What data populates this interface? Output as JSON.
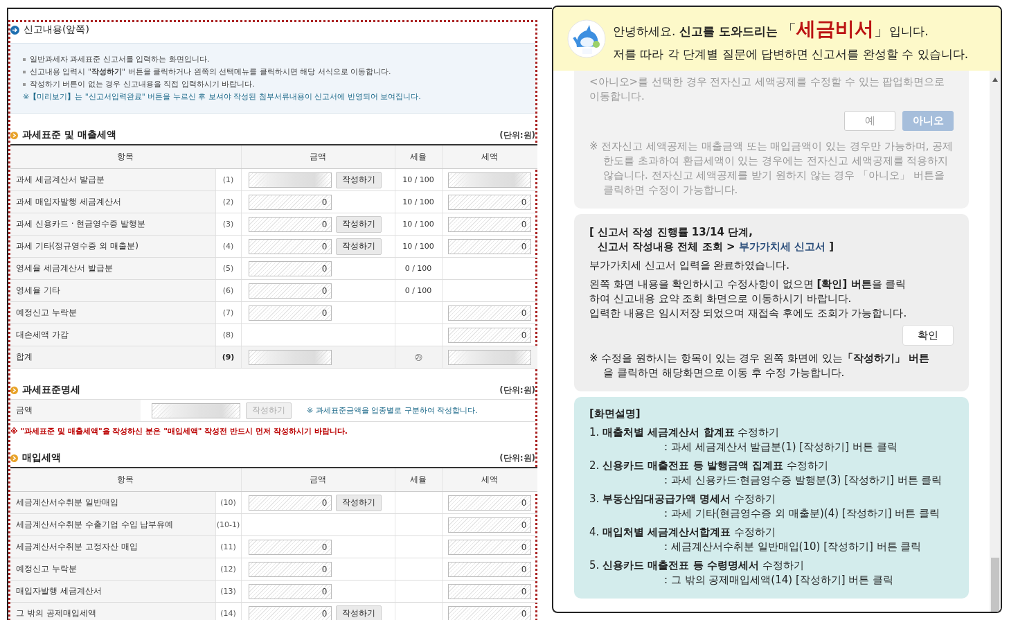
{
  "form": {
    "title": "신고내용(앞쪽)",
    "info": {
      "bullets": [
        "일반과세자 과세표준 신고서를 입력하는 화면입니다.",
        "신고내용 입력시 \"**작성하기**\" 버튼을 클릭하거나 왼쪽의 선택메뉴를 클릭하시면 해당 서식으로 이동합니다.",
        "작성하기 버튼이 없는 경우 신고내용을 직접 입력하시기 바랍니다."
      ],
      "note": "※**【**미리보기**】**는 \"신고서입력완료\" 버튼을 누르신 후 보셔야 작성된 첨부서류내용이 신고서에 반영되어 보여집니다."
    },
    "sales": {
      "title": "과세표준 및 매출세액",
      "unit": "(단위:원)",
      "columns": [
        "항목",
        "금액",
        "세율",
        "세액"
      ],
      "rows": [
        {
          "label": "과세 세금계산서 발급분",
          "no": "(1)",
          "amount": {
            "masked": true
          },
          "button": "작성하기",
          "rate": "10 / 100",
          "tax": {
            "masked": true
          },
          "total": false
        },
        {
          "label": "과세 매입자발행 세금계산서",
          "no": "(2)",
          "amount": {
            "value": "0"
          },
          "rate": "10 / 100",
          "tax": {
            "value": "0"
          },
          "total": false
        },
        {
          "label": "과세 신용카드 · 현금영수증 발행분",
          "no": "(3)",
          "amount": {
            "value": "0"
          },
          "button": "작성하기",
          "rate": "10 / 100",
          "tax": {
            "value": "0"
          },
          "total": false
        },
        {
          "label": "과세 기타(정규영수증 외 매출분)",
          "no": "(4)",
          "amount": {
            "value": "0"
          },
          "button": "작성하기",
          "rate": "10 / 100",
          "tax": {
            "value": "0"
          },
          "total": false
        },
        {
          "label": "영세율 세금계산서 발급분",
          "no": "(5)",
          "amount": {
            "value": "0"
          },
          "rate": "0 / 100",
          "total": false
        },
        {
          "label": "영세율 기타",
          "no": "(6)",
          "amount": {
            "value": "0"
          },
          "rate": "0 / 100",
          "total": false
        },
        {
          "label": "예정신고 누락분",
          "no": "(7)",
          "amount": {
            "value": "0"
          },
          "tax": {
            "value": "0"
          },
          "total": false
        },
        {
          "label": "대손세액 가감",
          "no": "(8)",
          "tax": {
            "value": "0"
          },
          "total": false
        },
        {
          "label": "합계",
          "no": "(9)",
          "amount": {
            "masked": true
          },
          "rate": "㉮",
          "tax": {
            "masked": true
          },
          "total": true
        }
      ]
    },
    "standard": {
      "title": "과세표준명세",
      "unit": "(단위:원)",
      "label": "금액",
      "amount": {
        "masked": true
      },
      "button": {
        "label": "작성하기",
        "disabled": true
      },
      "note": "※ 과세표준금액을 업종별로 구분하여 작성합니다."
    },
    "warning": "※ \"과세표준 및 매출세액\"을 작성하신 분은 \"매입세액\" 작성전 반드시 먼저 작성하시기 바랍니다.",
    "purchases": {
      "title": "매입세액",
      "unit": "(단위:원)",
      "columns": [
        "항목",
        "금액",
        "세율",
        "세액"
      ],
      "rows": [
        {
          "label": "세금계산서수취분 일반매입",
          "no": "(10)",
          "amount": {
            "value": "0"
          },
          "button": "작성하기",
          "tax": {
            "value": "0"
          },
          "total": false
        },
        {
          "label": "세금계산서수취분 수출기업 수입 납부유예",
          "no": "(10-1)",
          "tax": {
            "value": "0"
          },
          "total": false
        },
        {
          "label": "세금계산서수취분 고정자산 매입",
          "no": "(11)",
          "amount": {
            "value": "0"
          },
          "tax": {
            "value": "0"
          },
          "total": false
        },
        {
          "label": "예정신고 누락분",
          "no": "(12)",
          "amount": {
            "value": "0"
          },
          "tax": {
            "value": "0"
          },
          "total": false
        },
        {
          "label": "매입자발행 세금계산서",
          "no": "(13)",
          "amount": {
            "value": "0"
          },
          "tax": {
            "value": "0"
          },
          "total": false
        },
        {
          "label": "그 밖의 공제매입세액",
          "no": "(14)",
          "amount": {
            "value": "0"
          },
          "button": "작성하기",
          "tax": {
            "value": "0"
          },
          "total": false
        }
      ]
    }
  },
  "assistant": {
    "intro": {
      "before": "안녕하세요. ",
      "bold": "신고를 도와드리는",
      "open": "「",
      "name": "세금비서",
      "close": "」입니다."
    },
    "subtitle": "저를 따라 각 단계별 질문에 답변하면 신고서를 완성할 수 있습니다.",
    "cards": [
      {
        "kind": "question",
        "disabled": true,
        "text": "<아니오>를 선택한 경우 전자신고 세액공제를 수정할 수 있는 팝업화면으로 이동합니다.",
        "buttons": [
          {
            "label": "예",
            "selected": false
          },
          {
            "label": "아니오",
            "selected": true
          }
        ],
        "note": "※ 전자신고 세액공제는 매출금액 또는 매입금액이 있는 경우만 가능하며, 공제한도를 초과하여 환급세액이 있는 경우에는 전자신고 세액공제를 적용하지 않습니다. 전자신고 세액공제를 받기 원하지 않는 경우 「아니오」 버튼을 클릭하면 수정이 가능합니다."
      },
      {
        "kind": "progress",
        "title": {
          "line1": "[ 신고서 작성 진행률 13/14 단계,",
          "line2": "신고서 작성내용 전체 조회 > ",
          "link": "부가가치세 신고서",
          "close": " ]"
        },
        "paragraphs": [
          "부가가치세 신고서 입력을 완료하였습니다.",
          "왼쪽 화면 내용을 확인하시고 수정사항이 없으면 **[확인] 버튼**을 클릭\n하여 신고내용 요약 조회 화면으로 이동하시기 바랍니다.\n입력한 내용은 임시저장 되었으며 재접속 후에도 조회가 가능합니다."
        ],
        "button": "확인",
        "note": "※ 수정을 원하시는 항목이 있는 경우 왼쪽 화면에 있는**「작성하기」 버튼**\n을 클릭하면 해당화면으로 이동 후 수정 가능합니다."
      },
      {
        "kind": "help",
        "heading": "[화면설명]",
        "items": [
          {
            "title": "1. **매출처별 세금계산서 합계표** 수정하기",
            "detail": ": 과세 세금계산서 발급분(1) [작성하기] 버튼 클릭"
          },
          {
            "title": "2. **신용카드 매출전표 등 발행금액 집계표** 수정하기",
            "detail": ": 과세 신용카드·현금영수증 발행분(3) [작성하기] 버튼 클릭"
          },
          {
            "title": "3. **부동산임대공급가액 명세서** 수정하기",
            "detail": ": 과세 기타(현금영수증 외 매출분)(4) [작성하기] 버튼 클릭"
          },
          {
            "title": "4. **매입처별 세금계산서합계표** 수정하기",
            "detail": ": 세금계산서수취분 일반매입(10) [작성하기] 버튼 클릭"
          },
          {
            "title": "5. **신용카드 매출전표 등 수령명세서** 수정하기",
            "detail": ": 그 밖의 공제매입세액(14) [작성하기] 버튼 클릭"
          }
        ]
      }
    ]
  }
}
